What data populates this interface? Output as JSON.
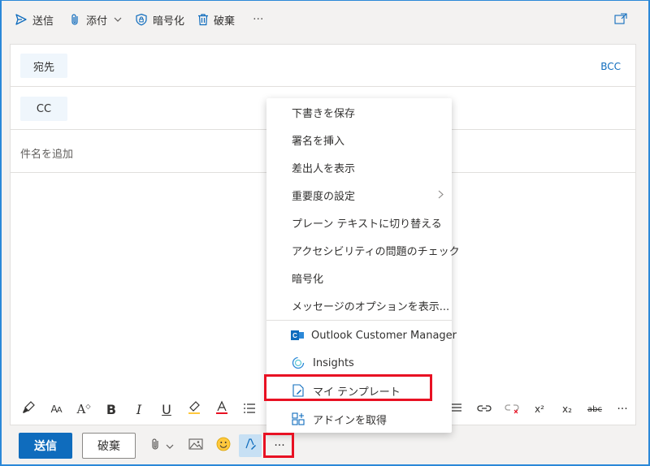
{
  "commandbar": {
    "send": "送信",
    "attach": "添付",
    "encrypt": "暗号化",
    "discard": "破棄",
    "more": "···"
  },
  "recipients": {
    "to": "宛先",
    "cc": "CC",
    "bcc": "BCC",
    "subject_placeholder": "件名を追加"
  },
  "menu": {
    "items": [
      {
        "label": "下書きを保存"
      },
      {
        "label": "署名を挿入"
      },
      {
        "label": "差出人を表示"
      },
      {
        "label": "重要度の設定",
        "submenu": true
      },
      {
        "label": "プレーン テキストに切り替える"
      },
      {
        "label": "アクセシビリティの問題のチェック"
      },
      {
        "label": "暗号化"
      },
      {
        "label": "メッセージのオプションを表示..."
      }
    ],
    "addins": [
      {
        "label": "Outlook Customer Manager",
        "icon": "outlook-customer-manager-icon"
      },
      {
        "label": "Insights",
        "icon": "insights-icon"
      },
      {
        "label": "マイ テンプレート",
        "icon": "my-templates-icon"
      },
      {
        "label": "アドインを取得",
        "icon": "get-addins-icon"
      }
    ]
  },
  "format": {
    "bold": "B",
    "italic": "I",
    "underline": "U",
    "font_size": "A",
    "superscript": "x²",
    "subscript": "x₂",
    "strike": "abc",
    "more": "···"
  },
  "actions": {
    "send": "送信",
    "discard": "破棄",
    "more": "···"
  },
  "colors": {
    "accent": "#0f6cbd",
    "highlight": "#e81123"
  }
}
